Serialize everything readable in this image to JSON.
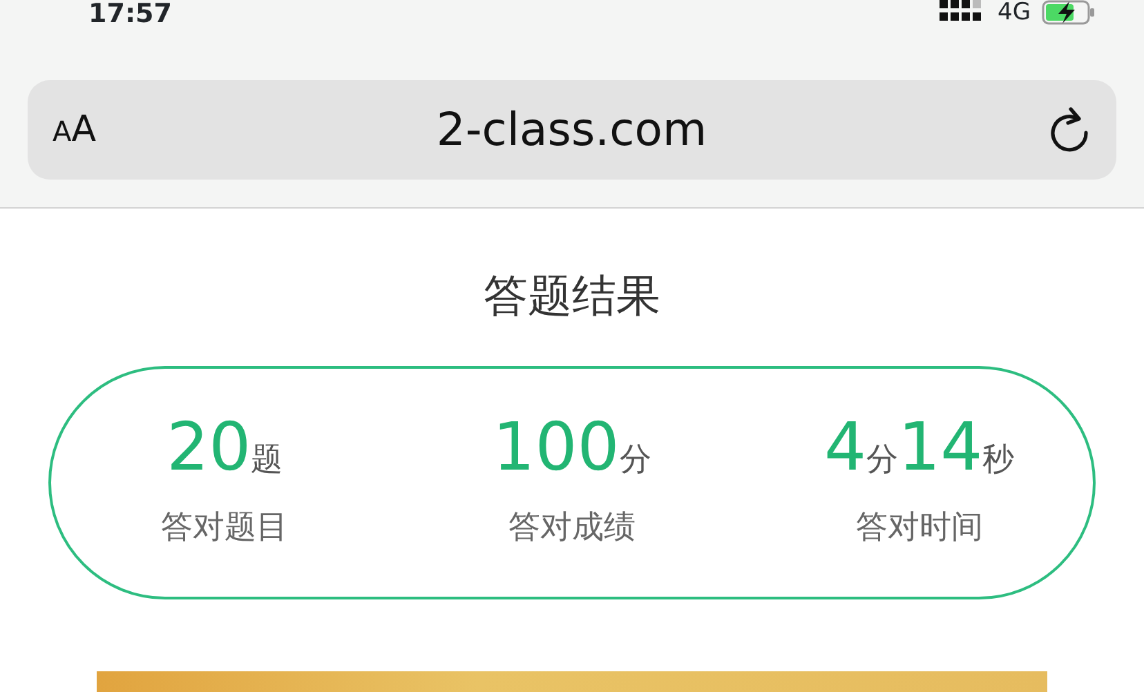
{
  "status_bar": {
    "time": "17:57",
    "network": "4G",
    "charging": true
  },
  "address_bar": {
    "text_size_button": "AA",
    "url": "2-class.com"
  },
  "page": {
    "title": "答题结果",
    "stats": [
      {
        "value": [
          {
            "kind": "number",
            "text": "20"
          },
          {
            "kind": "unit",
            "text": "题"
          }
        ],
        "label": "答对题目"
      },
      {
        "value": [
          {
            "kind": "number",
            "text": "100"
          },
          {
            "kind": "unit",
            "text": "分"
          }
        ],
        "label": "答对成绩"
      },
      {
        "value": [
          {
            "kind": "number",
            "text": "4"
          },
          {
            "kind": "unit",
            "text": "分"
          },
          {
            "kind": "number",
            "text": "14"
          },
          {
            "kind": "unit",
            "text": "秒"
          }
        ],
        "label": "答对时间"
      }
    ]
  }
}
